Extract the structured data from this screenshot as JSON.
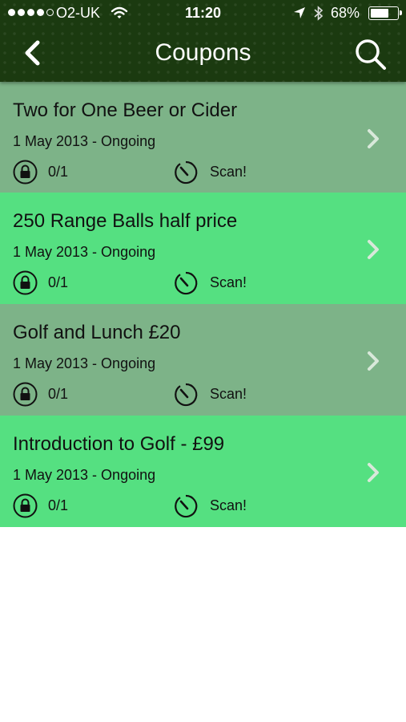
{
  "status_bar": {
    "carrier": "O2-UK",
    "time": "11:20",
    "battery": "68%"
  },
  "nav": {
    "title": "Coupons",
    "back_icon": "chevron-left-icon",
    "search_icon": "search-icon"
  },
  "coupons": [
    {
      "title": "Two for One Beer or Cider",
      "dates": "1 May 2013 - Ongoing",
      "count": "0/1",
      "action": "Scan!"
    },
    {
      "title": "250 Range Balls half price",
      "dates": "1 May 2013 - Ongoing",
      "count": "0/1",
      "action": "Scan!"
    },
    {
      "title": "Golf and Lunch £20",
      "dates": "1 May 2013 - Ongoing",
      "count": "0/1",
      "action": "Scan!"
    },
    {
      "title": "Introduction to Golf - £99",
      "dates": "1 May 2013 - Ongoing",
      "count": "0/1",
      "action": "Scan!"
    }
  ],
  "colors": {
    "header": "#1b3a10",
    "row_odd": "#7db388",
    "row_even": "#55e081",
    "chevron": "#d8e8da"
  }
}
